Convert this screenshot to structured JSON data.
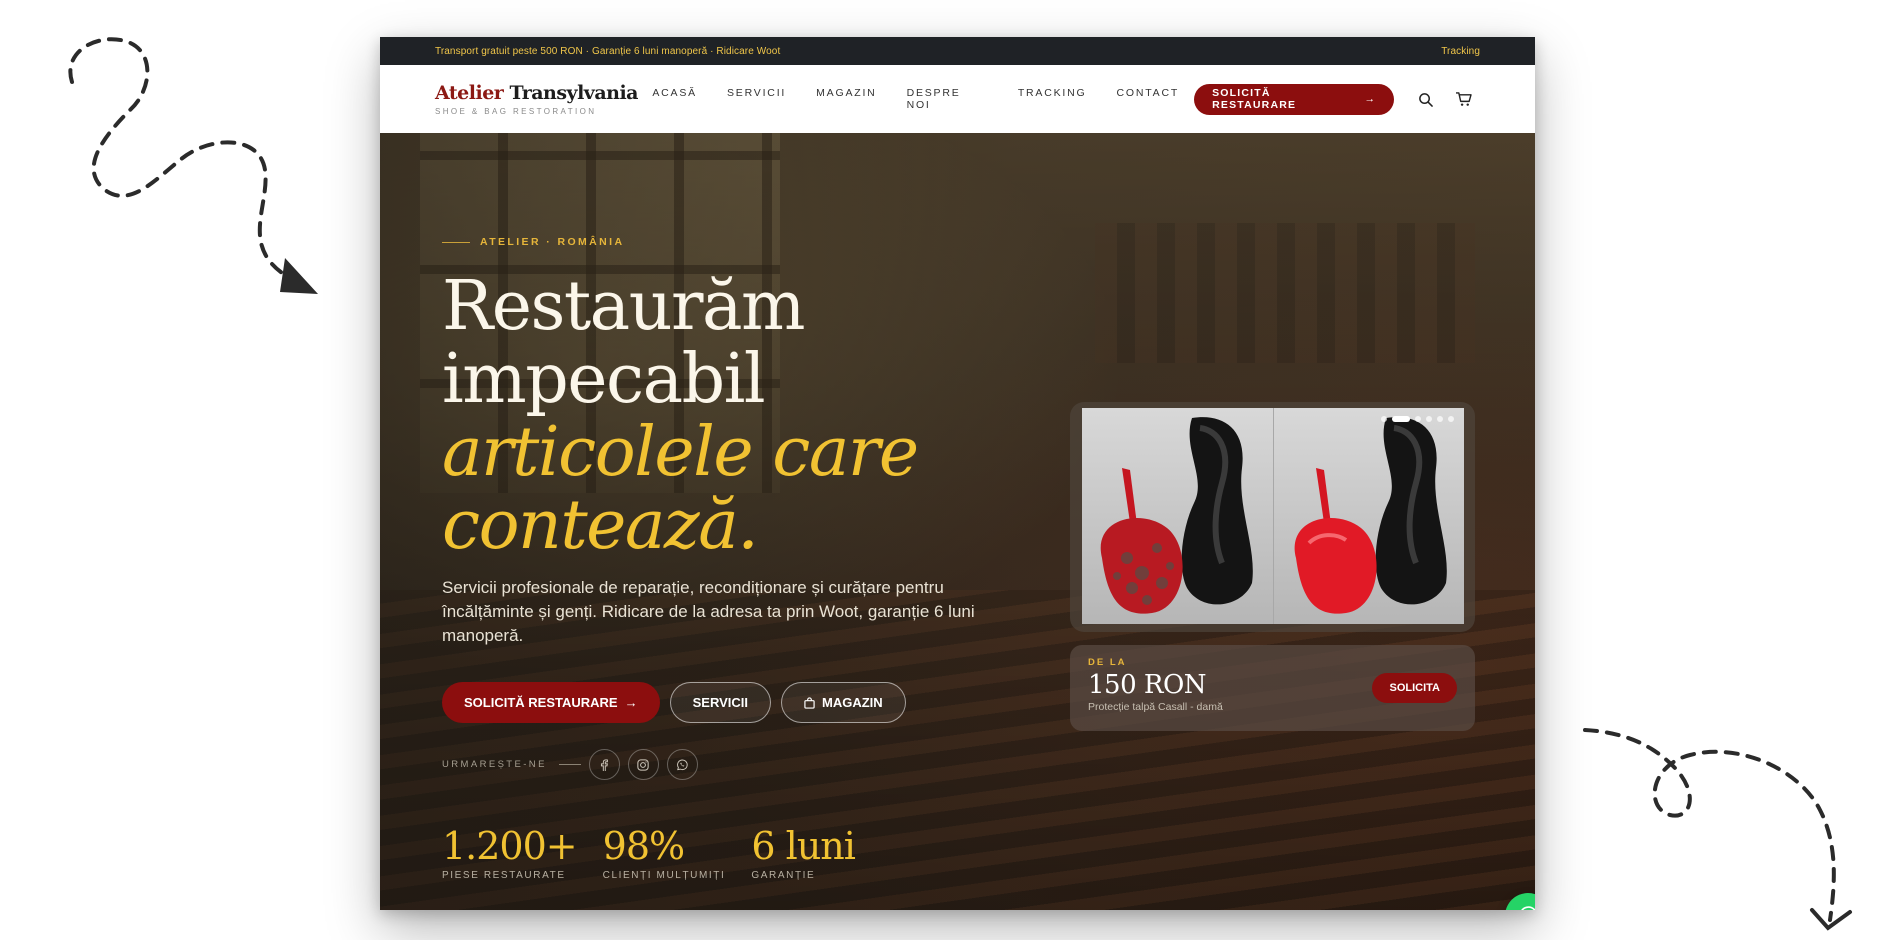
{
  "topbar": {
    "announcement": "Transport gratuit peste 500 RON · Garanție 6 luni manoperă · Ridicare Woot",
    "tracking_link": "Tracking"
  },
  "header": {
    "logo_accent": "Atelier",
    "logo_main": "Transylvania",
    "logo_sub": "SHOE & BAG RESTORATION",
    "nav": [
      "ACASĂ",
      "SERVICII",
      "MAGAZIN",
      "DESPRE NOI",
      "TRACKING",
      "CONTACT"
    ],
    "cta_label": "SOLICITĂ RESTAURARE",
    "icons": [
      "search-icon",
      "cart-icon"
    ]
  },
  "hero": {
    "kicker": "ATELIER · ROMÂNIA",
    "title_line1": "Restaurăm",
    "title_line2": "impecabil",
    "title_line3": "articolele care",
    "title_line4": "contează.",
    "lead": "Servicii profesionale de reparație, recondiționare și curățare pentru încălțăminte și genți. Ridicare de la adresa ta prin Woot, garanție 6 luni manoperă.",
    "buttons": {
      "primary": "SOLICITĂ RESTAURARE",
      "services": "SERVICII",
      "shop": "MAGAZIN"
    },
    "social_label": "URMAREȘTE-NE",
    "social_icons": [
      "facebook-icon",
      "instagram-icon",
      "whatsapp-icon"
    ],
    "stats": [
      {
        "value": "1.200+",
        "label": "PIESE RESTAURATE"
      },
      {
        "value": "98%",
        "label": "CLIENȚI MULȚUMIȚI"
      },
      {
        "value": "6 luni",
        "label": "GARANȚIE"
      }
    ]
  },
  "product_card": {
    "slides_total": 6,
    "slide_active": 2,
    "price_kicker": "DE LA",
    "price": "150 RON",
    "description": "Protecție talpă Casall - damă",
    "button": "SOLICITA"
  },
  "colors": {
    "accent_red": "#8c0e0e",
    "gold": "#f1c232",
    "topbar_bg": "#1f2226",
    "whatsapp": "#25d366"
  }
}
